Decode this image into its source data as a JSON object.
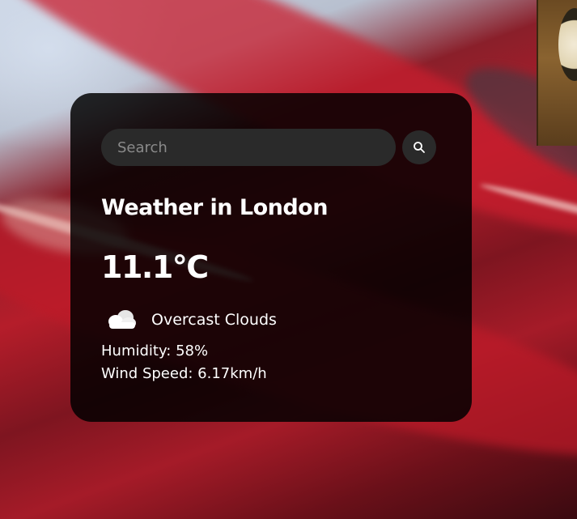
{
  "search": {
    "placeholder": "Search",
    "value": ""
  },
  "weather": {
    "city_heading": "Weather in London",
    "temperature": "11.1°C",
    "description": "Overcast Clouds",
    "humidity": "Humidity: 58%",
    "wind_speed": "Wind Speed: 6.17km/h"
  },
  "icons": {
    "search_button_icon": "search-icon",
    "weather_icon": "cloud-icon"
  },
  "colors": {
    "card_background": "#0f0f0f",
    "input_background": "#2a2a2a",
    "text": "#ffffff",
    "placeholder": "#8a8a8a"
  }
}
